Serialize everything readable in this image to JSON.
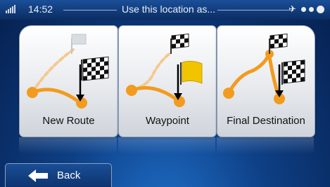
{
  "status_bar": {
    "time": "14:52",
    "title": "Use this location as..."
  },
  "cards": [
    {
      "label": "New Route",
      "icon": "new-route-icon"
    },
    {
      "label": "Waypoint",
      "icon": "waypoint-icon"
    },
    {
      "label": "Final Destination",
      "icon": "final-destination-icon"
    }
  ],
  "back_button": {
    "label": "Back",
    "icon": "left-arrow-icon"
  },
  "colors": {
    "route_orange": "#f29b1f",
    "accent_blue": "#0e3f85",
    "waypoint_flag_yellow": "#f2c400"
  }
}
